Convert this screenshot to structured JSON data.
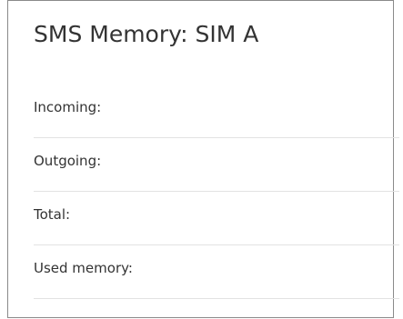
{
  "panel": {
    "title": "SMS Memory: SIM A",
    "rows": [
      {
        "label": "Incoming:",
        "value": ""
      },
      {
        "label": "Outgoing:",
        "value": ""
      },
      {
        "label": "Total:",
        "value": ""
      },
      {
        "label": "Used memory:",
        "value": ""
      }
    ]
  }
}
